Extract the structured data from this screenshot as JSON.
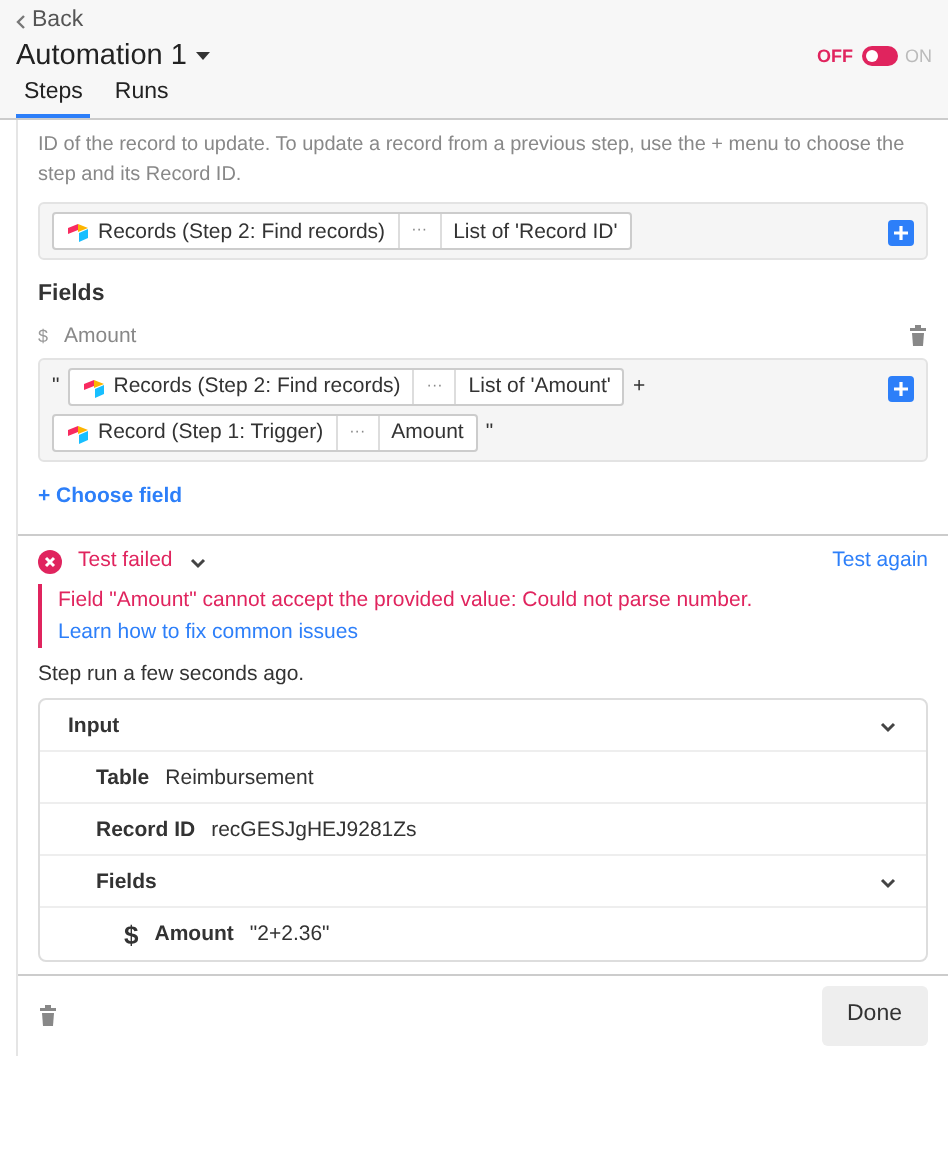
{
  "back": {
    "label": "Back"
  },
  "title": "Automation 1",
  "toggle": {
    "off_label": "OFF",
    "on_label": "ON",
    "on": false
  },
  "tabs": [
    {
      "label": "Steps",
      "selected": true
    },
    {
      "label": "Runs",
      "selected": false
    }
  ],
  "record_id": {
    "description": "ID of the record to update. To update a record from a previous step, use the + menu to choose the step and its Record ID.",
    "lines": [
      [
        {
          "kind": "pill",
          "source": "Records (Step 2: Find records)",
          "more": "···",
          "value": "List of 'Record ID'"
        }
      ]
    ]
  },
  "fields_heading": "Fields",
  "field": {
    "symbol": "$",
    "label": "Amount",
    "lines": [
      [
        {
          "kind": "text",
          "text": "\""
        },
        {
          "kind": "pill",
          "source": "Records (Step 2: Find records)",
          "more": "···",
          "value": "List of 'Amount'"
        },
        {
          "kind": "text",
          "text": "+"
        }
      ],
      [
        {
          "kind": "pill",
          "source": "Record (Step 1: Trigger)",
          "more": "···",
          "value": "Amount"
        },
        {
          "kind": "text",
          "text": "\""
        }
      ]
    ]
  },
  "choose_field": "+ Choose field",
  "test": {
    "status": "Test failed",
    "failed": true,
    "action": "Test again",
    "error": "Field \"Amount\" cannot accept the provided value: Could not parse number.",
    "help_link": "Learn how to fix common issues",
    "ran": "Step run a few seconds ago."
  },
  "input": {
    "title": "Input",
    "expanded": true,
    "rows": [
      {
        "label": "Table",
        "value": "Reimbursement"
      },
      {
        "label": "Record ID",
        "value": "recGESJgHEJ9281Zs"
      },
      {
        "label": "Fields",
        "expanded": true,
        "children": [
          {
            "label": "Amount",
            "value": "\"2+2.36\""
          }
        ]
      }
    ]
  },
  "done": "Done"
}
